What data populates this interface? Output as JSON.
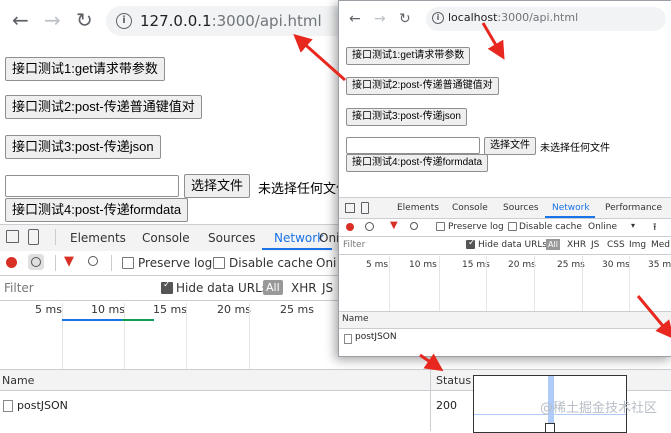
{
  "back_window": {
    "nav": {
      "back": "←",
      "forward": "→",
      "reload": "↻"
    },
    "url": {
      "host": "127.0.0.1",
      "rest": ":3000/api.html"
    },
    "buttons": {
      "test1": "接口测试1:get请求带参数",
      "test2": "接口测试2:post-传递普通键值对",
      "test3": "接口测试3:post-传递json",
      "choose_file": "选择文件",
      "no_file": "未选择任何文件",
      "test4": "接口测试4:post-传递formdata"
    },
    "devtools": {
      "tabs": [
        "Elements",
        "Console",
        "Sources",
        "Network"
      ],
      "extra_tab": "Oni",
      "toolbar": {
        "preserve_log": "Preserve log",
        "disable_cache": "Disable cache"
      },
      "filter": {
        "placeholder": "Filter",
        "hide_data_urls": "Hide data URLs",
        "all": "All",
        "xhr": "XHR",
        "js": "JS"
      },
      "ticks": [
        "5 ms",
        "10 ms",
        "15 ms",
        "20 ms",
        "25 ms"
      ],
      "columns": {
        "name": "Name",
        "status": "Status"
      },
      "rows": [
        {
          "name": "postJSON",
          "status": "200"
        }
      ]
    }
  },
  "front_window": {
    "nav": {
      "back": "←",
      "forward": "→",
      "reload": "↻"
    },
    "url": {
      "host": "localhost",
      "rest": ":3000/api.html"
    },
    "buttons": {
      "test1": "接口测试1:get请求带参数",
      "test2": "接口测试2:post-传递普通键值对",
      "test3": "接口测试3:post-传递json",
      "choose_file": "选择文件",
      "no_file": "未选择任何文件",
      "test4": "接口测试4:post-传递formdata"
    },
    "devtools": {
      "tabs": [
        "Elements",
        "Console",
        "Sources",
        "Network",
        "Performance"
      ],
      "toolbar": {
        "preserve_log": "Preserve log",
        "disable_cache": "Disable cache",
        "online": "Online"
      },
      "filter": {
        "placeholder": "Filter",
        "hide_data_urls": "Hide data URLs",
        "all": "All",
        "types": [
          "XHR",
          "JS",
          "CSS",
          "Img",
          "Med"
        ]
      },
      "ticks": [
        "5 ms",
        "10 ms",
        "15 ms",
        "20 ms",
        "25 ms",
        "30 ms",
        "35 m"
      ],
      "columns": {
        "name": "Name"
      },
      "rows": [
        {
          "name": "postJSON"
        }
      ]
    }
  },
  "watermark": "@稀土掘金技术社区",
  "colors": {
    "accent": "#1a73e8",
    "annotation_arrow": "#e8281e",
    "record": "#d93025"
  }
}
